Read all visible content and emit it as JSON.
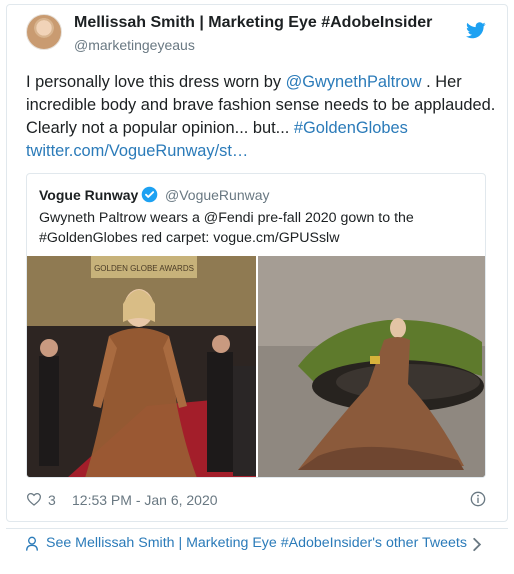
{
  "author": {
    "name": "Mellissah Smith | Marketing Eye #AdobeInsider",
    "handle": "@marketingeyeaus",
    "avatar_icon": "profile-photo"
  },
  "brand_icon": "twitter-bird-icon",
  "tweet": {
    "text_1": "I personally love this dress worn by ",
    "mention": "@GwynethPaltrow",
    "text_2": " . Her incredible body and brave fashion sense needs to be applauded. Clearly not a popular opinion... but... ",
    "hashtag": "#GoldenGlobes",
    "link": "twitter.com/VogueRunway/st…"
  },
  "quoted_tweet": {
    "name": "Vogue Runway",
    "handle": "@VogueRunway",
    "text": "Gwyneth Paltrow wears a @Fendi pre-fall 2020 gown to the #GoldenGlobes red carpet: vogue.cm/GPUSslw",
    "photo_left_sign": "GOLDEN GLOBE AWARDS"
  },
  "meta": {
    "likes": "3",
    "timestamp": "12:53 PM - Jan 6, 2020"
  },
  "footer": {
    "link_text": "See Mellissah Smith | Marketing Eye #AdobeInsider's other Tweets"
  },
  "colors": {
    "link": "#2b7bb9",
    "twitter_blue": "#1da1f2",
    "muted": "#697882",
    "border": "#e1e8ed"
  }
}
